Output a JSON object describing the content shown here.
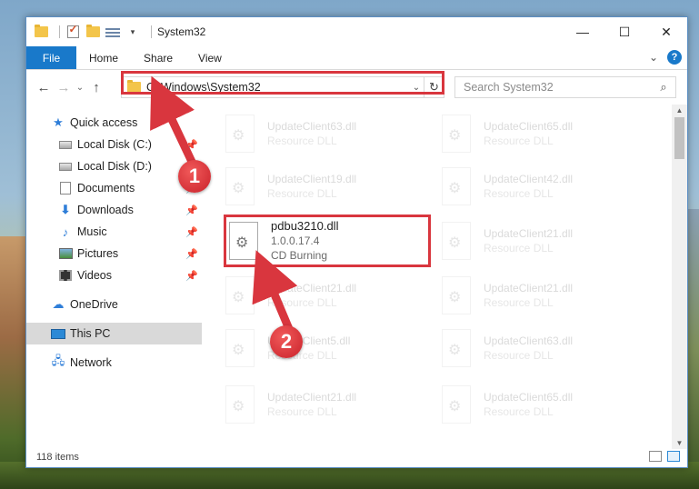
{
  "window": {
    "title": "System32",
    "caption": {
      "minimize": "—",
      "maximize": "☐",
      "close": "✕"
    }
  },
  "ribbon": {
    "tabs": [
      "File",
      "Home",
      "Share",
      "View"
    ],
    "expand": "⌄",
    "help": "?"
  },
  "nav": {
    "back": "←",
    "forward": "→",
    "recent": "⌄",
    "up": "↑",
    "address": "C:\\Windows\\System32",
    "address_drop": "⌄",
    "refresh": "↻",
    "search_placeholder": "Search System32",
    "search_icon": "⌕"
  },
  "sidebar": {
    "items": [
      {
        "label": "Quick access",
        "icon": "star-icon",
        "level": 1,
        "pinned": false
      },
      {
        "label": "Local Disk (C:)",
        "icon": "drive-icon",
        "level": 2,
        "pinned": true
      },
      {
        "label": "Local Disk (D:)",
        "icon": "drive-icon",
        "level": 2,
        "pinned": false
      },
      {
        "label": "Documents",
        "icon": "document-icon",
        "level": 2,
        "pinned": true
      },
      {
        "label": "Downloads",
        "icon": "download-icon",
        "level": 2,
        "pinned": true
      },
      {
        "label": "Music",
        "icon": "music-icon",
        "level": 2,
        "pinned": true
      },
      {
        "label": "Pictures",
        "icon": "pictures-icon",
        "level": 2,
        "pinned": true
      },
      {
        "label": "Videos",
        "icon": "videos-icon",
        "level": 2,
        "pinned": true
      },
      {
        "label": "OneDrive",
        "icon": "cloud-icon",
        "level": 1,
        "pinned": false
      },
      {
        "label": "This PC",
        "icon": "computer-icon",
        "level": 1,
        "pinned": false,
        "selected": true
      },
      {
        "label": "Network",
        "icon": "network-icon",
        "level": 1,
        "pinned": false
      }
    ],
    "pin_glyph": "📌"
  },
  "files": [
    {
      "name": "UpdateClient63.dll",
      "desc": "Resource DLL",
      "faded": true
    },
    {
      "name": "UpdateClient65.dll",
      "desc": "Resource DLL",
      "faded": true
    },
    {
      "name": "UpdateClient19.dll",
      "desc": "Resource DLL",
      "faded": true
    },
    {
      "name": "UpdateClient42.dll",
      "desc": "Resource DLL",
      "faded": true
    },
    {
      "name": "pdbu3210.dll",
      "version": "1.0.0.17.4",
      "desc": "CD Burning",
      "faded": false
    },
    {
      "name": "UpdateClient21.dll",
      "desc": "Resource DLL",
      "faded": true
    },
    {
      "name": "UpdateClient21.dll",
      "desc": "Resource DLL",
      "faded": true
    },
    {
      "name": "UpdateClient21.dll",
      "desc": "Resource DLL",
      "faded": true
    },
    {
      "name": "UpdateClient5.dll",
      "desc": "Resource DLL",
      "faded": true
    },
    {
      "name": "UpdateClient63.dll",
      "desc": "Resource DLL",
      "faded": true
    },
    {
      "name": "UpdateClient21.dll",
      "desc": "Resource DLL",
      "faded": true
    },
    {
      "name": "UpdateClient65.dll",
      "desc": "Resource DLL",
      "faded": true
    }
  ],
  "status": {
    "item_count": "118 items"
  },
  "annotations": {
    "step1": "1",
    "step2": "2",
    "highlight_color": "#d9363e"
  }
}
